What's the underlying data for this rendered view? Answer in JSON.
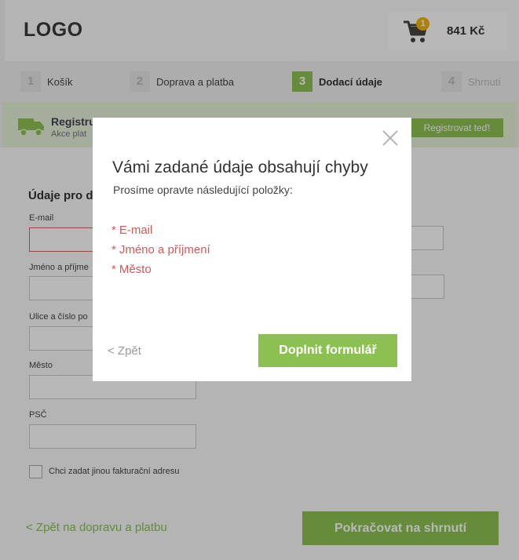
{
  "header": {
    "logo": "LOGO",
    "cart_count": "1",
    "cart_price": "841 Kč"
  },
  "steps": [
    {
      "num": "1",
      "label": "Košík"
    },
    {
      "num": "2",
      "label": "Doprava a platba"
    },
    {
      "num": "3",
      "label": "Dodací údaje"
    },
    {
      "num": "4",
      "label": "Shrnutí"
    }
  ],
  "banner": {
    "title": "Registru",
    "subtitle": "Akce plat",
    "button": "Registrovat teď!"
  },
  "form": {
    "title": "Údaje pro d",
    "email_label": "E-mail",
    "name_label": "Jméno a příjme",
    "street_label": "Ulice a číslo po",
    "city_label": "Město",
    "zip_label": "PSČ",
    "checkbox_label": "Chci zadat jinou fakturační adresu",
    "back_link": "< Zpět na dopravu a platbu",
    "continue_button": "Pokračovat na shrnutí"
  },
  "modal": {
    "title": "Vámi zadané údaje obsahují chyby",
    "subtitle": "Prosíme opravte následující položky:",
    "errors": [
      "E-mail",
      "Jméno a příjmení",
      "Město"
    ],
    "error_marker": "*",
    "back_button": "< Zpět",
    "fill_button": "Doplnit formulář"
  },
  "colors": {
    "accent": "#8cc152",
    "error": "#d15a5a",
    "badge": "#f0b400"
  }
}
